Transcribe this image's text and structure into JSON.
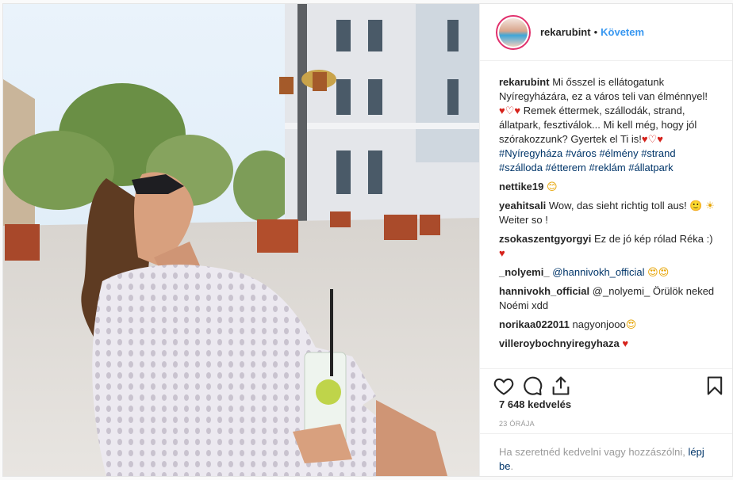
{
  "header": {
    "username": "rekarubint",
    "separator": "•",
    "follow_label": "Követem"
  },
  "caption": {
    "username": "rekarubint",
    "text_1": "Mi ősszel is ellátogatunk Nyíregyházára, ez a város teli van élménnyel! ",
    "hearts_1": "♥♡♥",
    "text_2": " Remek éttermek, szállodák, strand, állatpark, fesztiválok... Mi kell még, hogy jól szórakozzunk? Gyertek el Ti is!",
    "hearts_2": "♥♡♥",
    "hashtags": "#Nyíregyháza #város #élmény #strand #szálloda #étterem #reklám #állatpark"
  },
  "comments": [
    {
      "user": "nettike19",
      "text": "",
      "emoji": "😊"
    },
    {
      "user": "yeahitsali",
      "text": "Wow, das sieht richtig toll aus! ",
      "emoji": "🙂 ☀ ",
      "text_after": "Weiter so !"
    },
    {
      "user": "zsokaszentgyorgyi",
      "text": "Ez de jó kép rólad Réka :) ",
      "emoji": "♥"
    },
    {
      "user": "_nolyemi_",
      "text": "@hannivokh_official ",
      "emoji": "😍😍"
    },
    {
      "user": "hannivokh_official",
      "text": "@_nolyemi_ Örülök neked Noémi xdd",
      "emoji": ""
    },
    {
      "user": "norikaa022011",
      "text": "nagyonjooo",
      "emoji": "😍"
    },
    {
      "user": "villeroybochnyiregyhaza",
      "text": "",
      "emoji": "♥"
    }
  ],
  "icons": {
    "like": "heart-icon",
    "comment": "comment-icon",
    "share": "share-icon",
    "save": "bookmark-icon"
  },
  "likes_text": "7 648 kedvelés",
  "time_text": "23 ÓRÁJA",
  "login": {
    "prompt": "Ha szeretnéd kedvelni vagy hozzászólni, ",
    "link": "lépj be",
    "suffix": "."
  },
  "colors": {
    "link_blue": "#3897f0",
    "hashtag": "#003569",
    "heart_red": "#d6221b"
  }
}
